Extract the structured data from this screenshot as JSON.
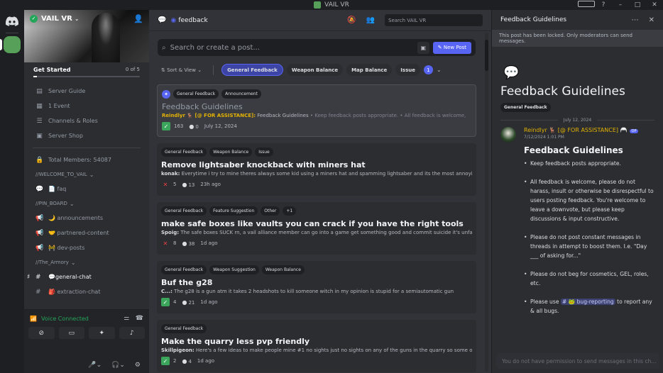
{
  "window": {
    "title": "VAIL VR"
  },
  "server": {
    "name": "VAIL VR",
    "get_started": "Get Started",
    "get_started_progress": "0 of 5",
    "get_started_fraction": 0.0
  },
  "sidebar": {
    "items": [
      {
        "label": "Server Guide"
      },
      {
        "label": "1 Event"
      },
      {
        "label": "Channels & Roles"
      },
      {
        "label": "Server Shop"
      }
    ],
    "members": "Total Members: 54087",
    "categories": [
      {
        "label": "//WELCOME_TO_VAIL",
        "channels": [
          {
            "label": "📄 faq"
          }
        ]
      },
      {
        "label": "//PIN_BOARD",
        "channels": [
          {
            "label": "🌙 announcements"
          },
          {
            "label": "🤝 partnered-content"
          },
          {
            "label": "🚧 dev-posts"
          }
        ]
      },
      {
        "label": "//The_Armory",
        "channels": [
          {
            "label": "💬general-chat"
          },
          {
            "label": "🎒 extraction-chat"
          }
        ]
      }
    ]
  },
  "voice": {
    "status": "Voice Connected"
  },
  "forum": {
    "channel_name": "feedback",
    "search_placeholder": "Search VAIL VR",
    "post_placeholder": "Search or create a post...",
    "new_post_label": "New Post",
    "sort_label": "Sort & View",
    "tag_filters": [
      "General Feedback",
      "Weapon Balance",
      "Map Balance",
      "Issue"
    ],
    "more_tags_count": "1",
    "posts": [
      {
        "tags": [
          "General Feedback",
          "Announcement"
        ],
        "title": "Feedback Guidelines",
        "author": "Reindlyr 🦌 [@ FOR ASSISTANCE]:",
        "preview": "Feedback Guidelines",
        "preview_extra": "• Keep feedback posts appropriate.     • All feedback is welcome,",
        "reaction": "163",
        "replies": "0",
        "time": "July 12, 2024"
      },
      {
        "tags": [
          "General Feedback",
          "Weapon Balance",
          "Issue"
        ],
        "title": "Remove lightsaber knockback with miners hat",
        "author": "konak:",
        "preview": "Everytime i try to mine theres always some kid using a miners hat and spamming lightsaber and its the most annoying thin...",
        "reaction": "5",
        "replies": "13",
        "time": "23h ago"
      },
      {
        "tags": [
          "General Feedback",
          "Feature Suggestion",
          "Other",
          "+1"
        ],
        "title": "make safe boxes like vaults you can crack if you have the right tools",
        "author": "Spoig:",
        "preview": "The safe boxes SUCK rn, a vail alliance member can go into a game get something good and commit suicide it's unfair. I und...",
        "reaction": "8",
        "replies": "38",
        "time": "1d ago"
      },
      {
        "tags": [
          "General Feedback",
          "Weapon Suggestion",
          "Weapon Balance"
        ],
        "title": "Buf the g28",
        "author": "C...:",
        "preview": "The g28 is a      gun atm it takes 2 headshots to kill someone witch in my opinion is stupid for a semiautomatic gun",
        "reaction": "4",
        "replies": "21",
        "time": "1d ago"
      },
      {
        "tags": [
          "General Feedback"
        ],
        "title": "Make the quarry less pvp friendly",
        "author": "Skillpigeon:",
        "preview": "Here's a few ideas to make people mine #1 no sights just no sights on any of the guns in the quarry so some of the kid...",
        "reaction": "2",
        "replies": "4",
        "time": "1d ago"
      }
    ]
  },
  "panel": {
    "title": "Feedback Guidelines",
    "locked_notice": "This post has been locked. Only moderators can send messages.",
    "post_title": "Feedback Guidelines",
    "tag": "General Feedback",
    "date": "July 12, 2024",
    "author": "Reindlyr 🦌 [@ FOR ASSISTANCE] 🦳",
    "op_badge": "OP",
    "time": "7/12/2024 1:01 PM",
    "heading": "Feedback Guidelines",
    "bullets": [
      "Keep feedback posts appropriate.",
      "All feedback is welcome, please do not harass, insult or otherwise be disrespectful to users posting feedback. You're welcome to leave a downvote, but please keep discussions & input constructive.",
      "Please do not post constant messages in threads in attempt to boost them. I.e. \"Day ___ of asking for...\"",
      "Please do not beg for cosmetics, GEL, roles, etc."
    ],
    "last_bullet_pre": "Please use ",
    "last_bullet_mention": "# 🐸 bug-reporting",
    "last_bullet_post": " to report any & all bugs.",
    "footer": "You do not have permission to send messages in this ch..."
  },
  "colors": {
    "accent": "#5865f2",
    "online": "#23a55a",
    "brand": "#57a05a"
  }
}
